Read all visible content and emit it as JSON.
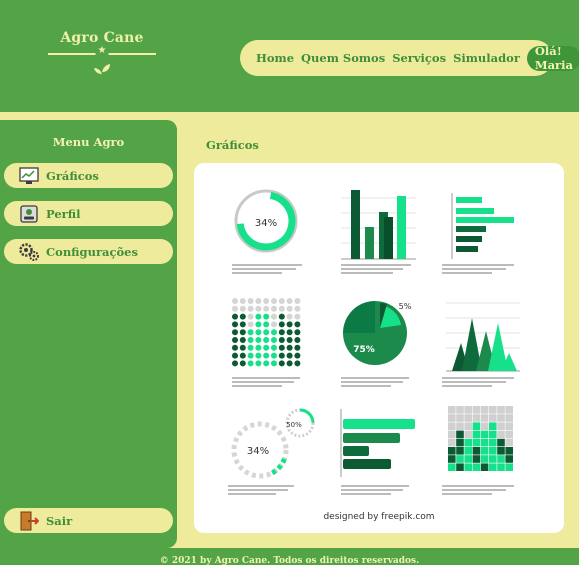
{
  "header": {
    "brand": "Agro Cane",
    "nav": [
      "Home",
      "Quem Somos",
      "Serviços",
      "Simulador"
    ],
    "greeting": "Olá! Maria"
  },
  "sidebar": {
    "title": "Menu Agro",
    "items": [
      {
        "label": "Gráficos",
        "icon": "chart-screen-icon"
      },
      {
        "label": "Perfil",
        "icon": "id-card-icon"
      },
      {
        "label": "Configurações",
        "icon": "gears-icon"
      }
    ],
    "logout": {
      "label": "Sair",
      "icon": "exit-door-icon"
    }
  },
  "main": {
    "title": "Gráficos",
    "infographic": {
      "donut_percent": "34%",
      "pie_large": "75%",
      "pie_small": "5%",
      "radial_small": "50%",
      "radial_big": "34%",
      "credit": "designed by freepik.com"
    }
  },
  "footer": {
    "text": "© 2021 by Agro Cane. Todos os direitos reservados."
  },
  "colors": {
    "green": "#52a447",
    "cream": "#eeeb9c",
    "dark_green": "#0b5a33",
    "mint": "#17e08a"
  }
}
